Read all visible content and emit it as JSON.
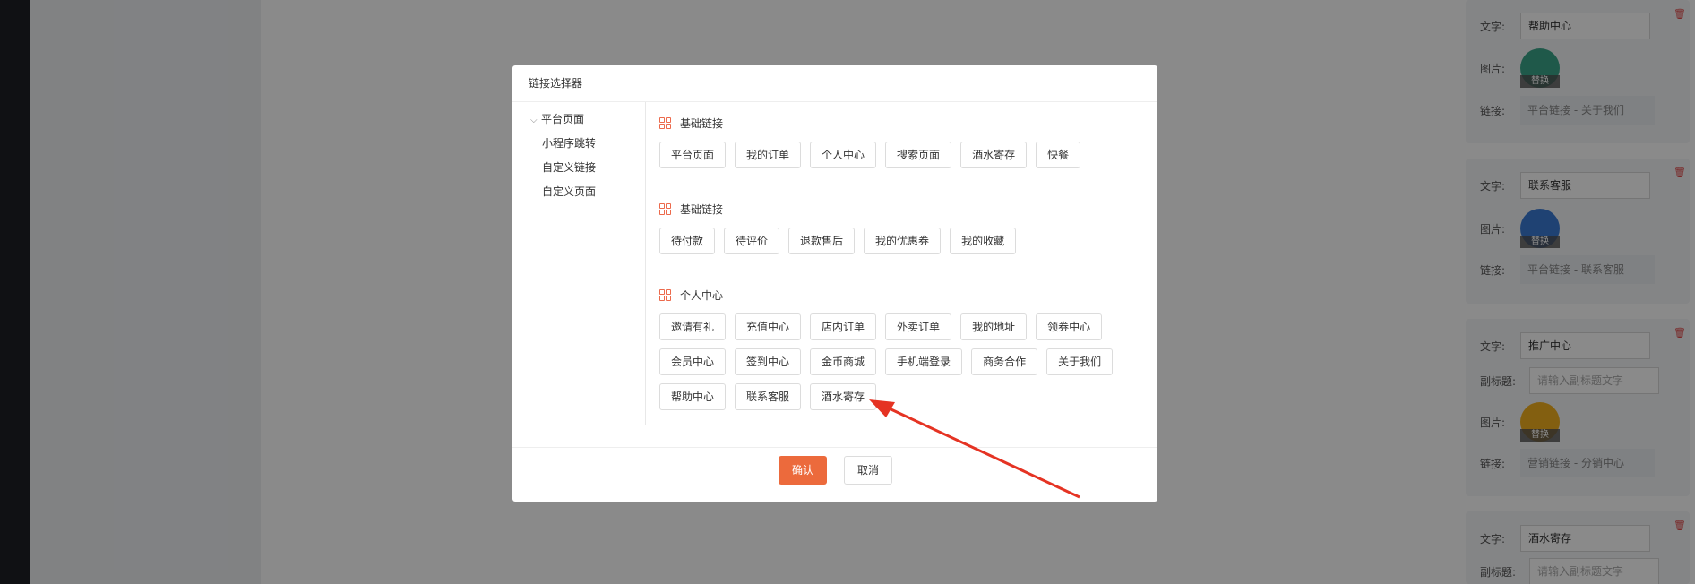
{
  "right_cards": [
    {
      "text_label": "文字:",
      "text_value": "帮助中心",
      "image_label": "图片:",
      "replace": "替换",
      "link_label": "链接:",
      "link_value": "平台链接 - 关于我们",
      "icon_color": "#3aa58a"
    },
    {
      "text_label": "文字:",
      "text_value": "联系客服",
      "image_label": "图片:",
      "replace": "替换",
      "link_label": "链接:",
      "link_value": "平台链接 - 联系客服",
      "icon_color": "#3a7bd5"
    },
    {
      "text_label": "文字:",
      "text_value": "推广中心",
      "subtitle_label": "副标题:",
      "subtitle_placeholder": "请输入副标题文字",
      "image_label": "图片:",
      "replace": "替换",
      "link_label": "链接:",
      "link_value": "营销链接 - 分销中心",
      "icon_color": "#f2b01e"
    },
    {
      "text_label": "文字:",
      "text_value": "酒水寄存",
      "subtitle_label": "副标题:",
      "subtitle_placeholder": "请输入副标题文字"
    }
  ],
  "modal": {
    "title": "链接选择器",
    "tree": {
      "root": "平台页面",
      "children": [
        "小程序跳转",
        "自定义链接",
        "自定义页面"
      ]
    },
    "sections": [
      {
        "title": "基础链接",
        "links": [
          "平台页面",
          "我的订单",
          "个人中心",
          "搜索页面",
          "酒水寄存",
          "快餐"
        ]
      },
      {
        "title": "基础链接",
        "links": [
          "待付款",
          "待评价",
          "退款售后",
          "我的优惠券",
          "我的收藏"
        ]
      },
      {
        "title": "个人中心",
        "links": [
          "邀请有礼",
          "充值中心",
          "店内订单",
          "外卖订单",
          "我的地址",
          "领券中心",
          "会员中心",
          "签到中心",
          "金币商城",
          "手机端登录",
          "商务合作",
          "关于我们",
          "帮助中心",
          "联系客服",
          "酒水寄存"
        ]
      }
    ],
    "confirm": "确认",
    "cancel": "取消"
  },
  "colors": {
    "accent": "#ec6a3c",
    "arrow": "#e53323",
    "trash": "#e04848"
  }
}
